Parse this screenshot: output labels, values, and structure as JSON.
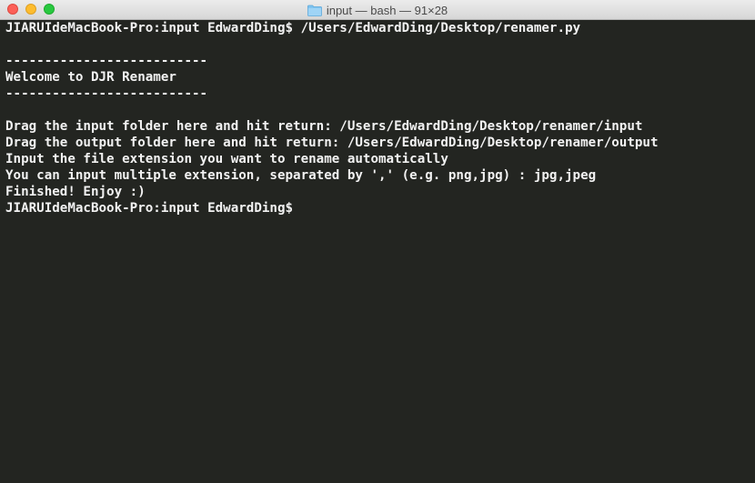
{
  "window": {
    "title": "input — bash — 91×28",
    "folder_icon": "folder-icon",
    "controls": [
      "close",
      "minimize",
      "zoom"
    ]
  },
  "terminal": {
    "lines": [
      "JIARUIdeMacBook-Pro:input EdwardDing$ /Users/EdwardDing/Desktop/renamer.py",
      "",
      "--------------------------",
      "Welcome to DJR Renamer",
      "--------------------------",
      "",
      "Drag the input folder here and hit return: /Users/EdwardDing/Desktop/renamer/input",
      "Drag the output folder here and hit return: /Users/EdwardDing/Desktop/renamer/output",
      "Input the file extension you want to rename automatically",
      "You can input multiple extension, separated by ',' (e.g. png,jpg) : jpg,jpeg",
      "Finished! Enjoy :)",
      "JIARUIdeMacBook-Pro:input EdwardDing$ "
    ]
  },
  "colors": {
    "background": "#232521",
    "text": "#f2f2f2",
    "close": "#fc5f57",
    "minimize": "#fdbc2e",
    "zoom": "#28c83f"
  }
}
